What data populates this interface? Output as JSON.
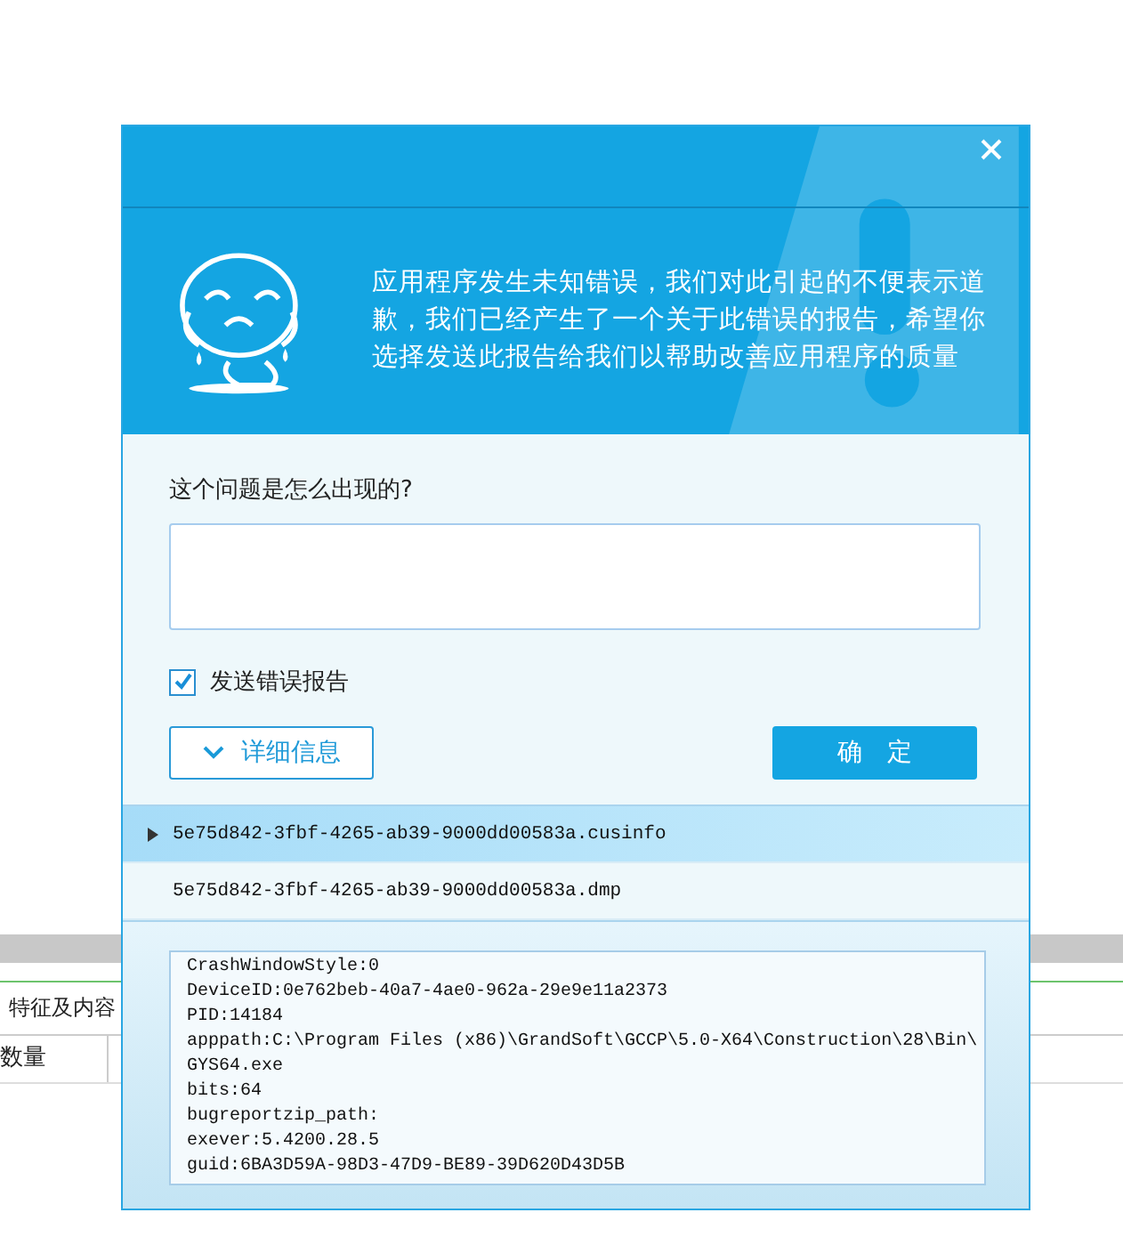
{
  "background_app": {
    "tab": "特征及内容",
    "column_header": "数量"
  },
  "dialog": {
    "message": "应用程序发生未知错误，我们对此引起的不便表示道歉，我们已经产生了一个关于此错误的报告，希望你选择发送此报告给我们以帮助改善应用程序的质量",
    "question": "这个问题是怎么出现的?",
    "send_report": {
      "label": "发送错误报告",
      "checked": true
    },
    "details_button": {
      "label": "详细信息",
      "expanded": true
    },
    "ok_button": "确　定",
    "files": [
      {
        "name": "5e75d842-3fbf-4265-ab39-9000dd00583a.cusinfo",
        "selected": true
      },
      {
        "name": "5e75d842-3fbf-4265-ab39-9000dd00583a.dmp",
        "selected": false
      }
    ],
    "log_lines": [
      "CrashWindowStyle:0",
      "DeviceID:0e762beb-40a7-4ae0-962a-29e9e11a2373",
      "PID:14184",
      "apppath:C:\\Program Files (x86)\\GrandSoft\\GCCP\\5.0-X64\\Construction\\28\\Bin\\",
      "GYS64.exe",
      "bits:64",
      "bugreportzip_path:",
      "exever:5.4200.28.5",
      "guid:6BA3D59A-98D3-47D9-BE89-39D620D43D5B"
    ]
  }
}
